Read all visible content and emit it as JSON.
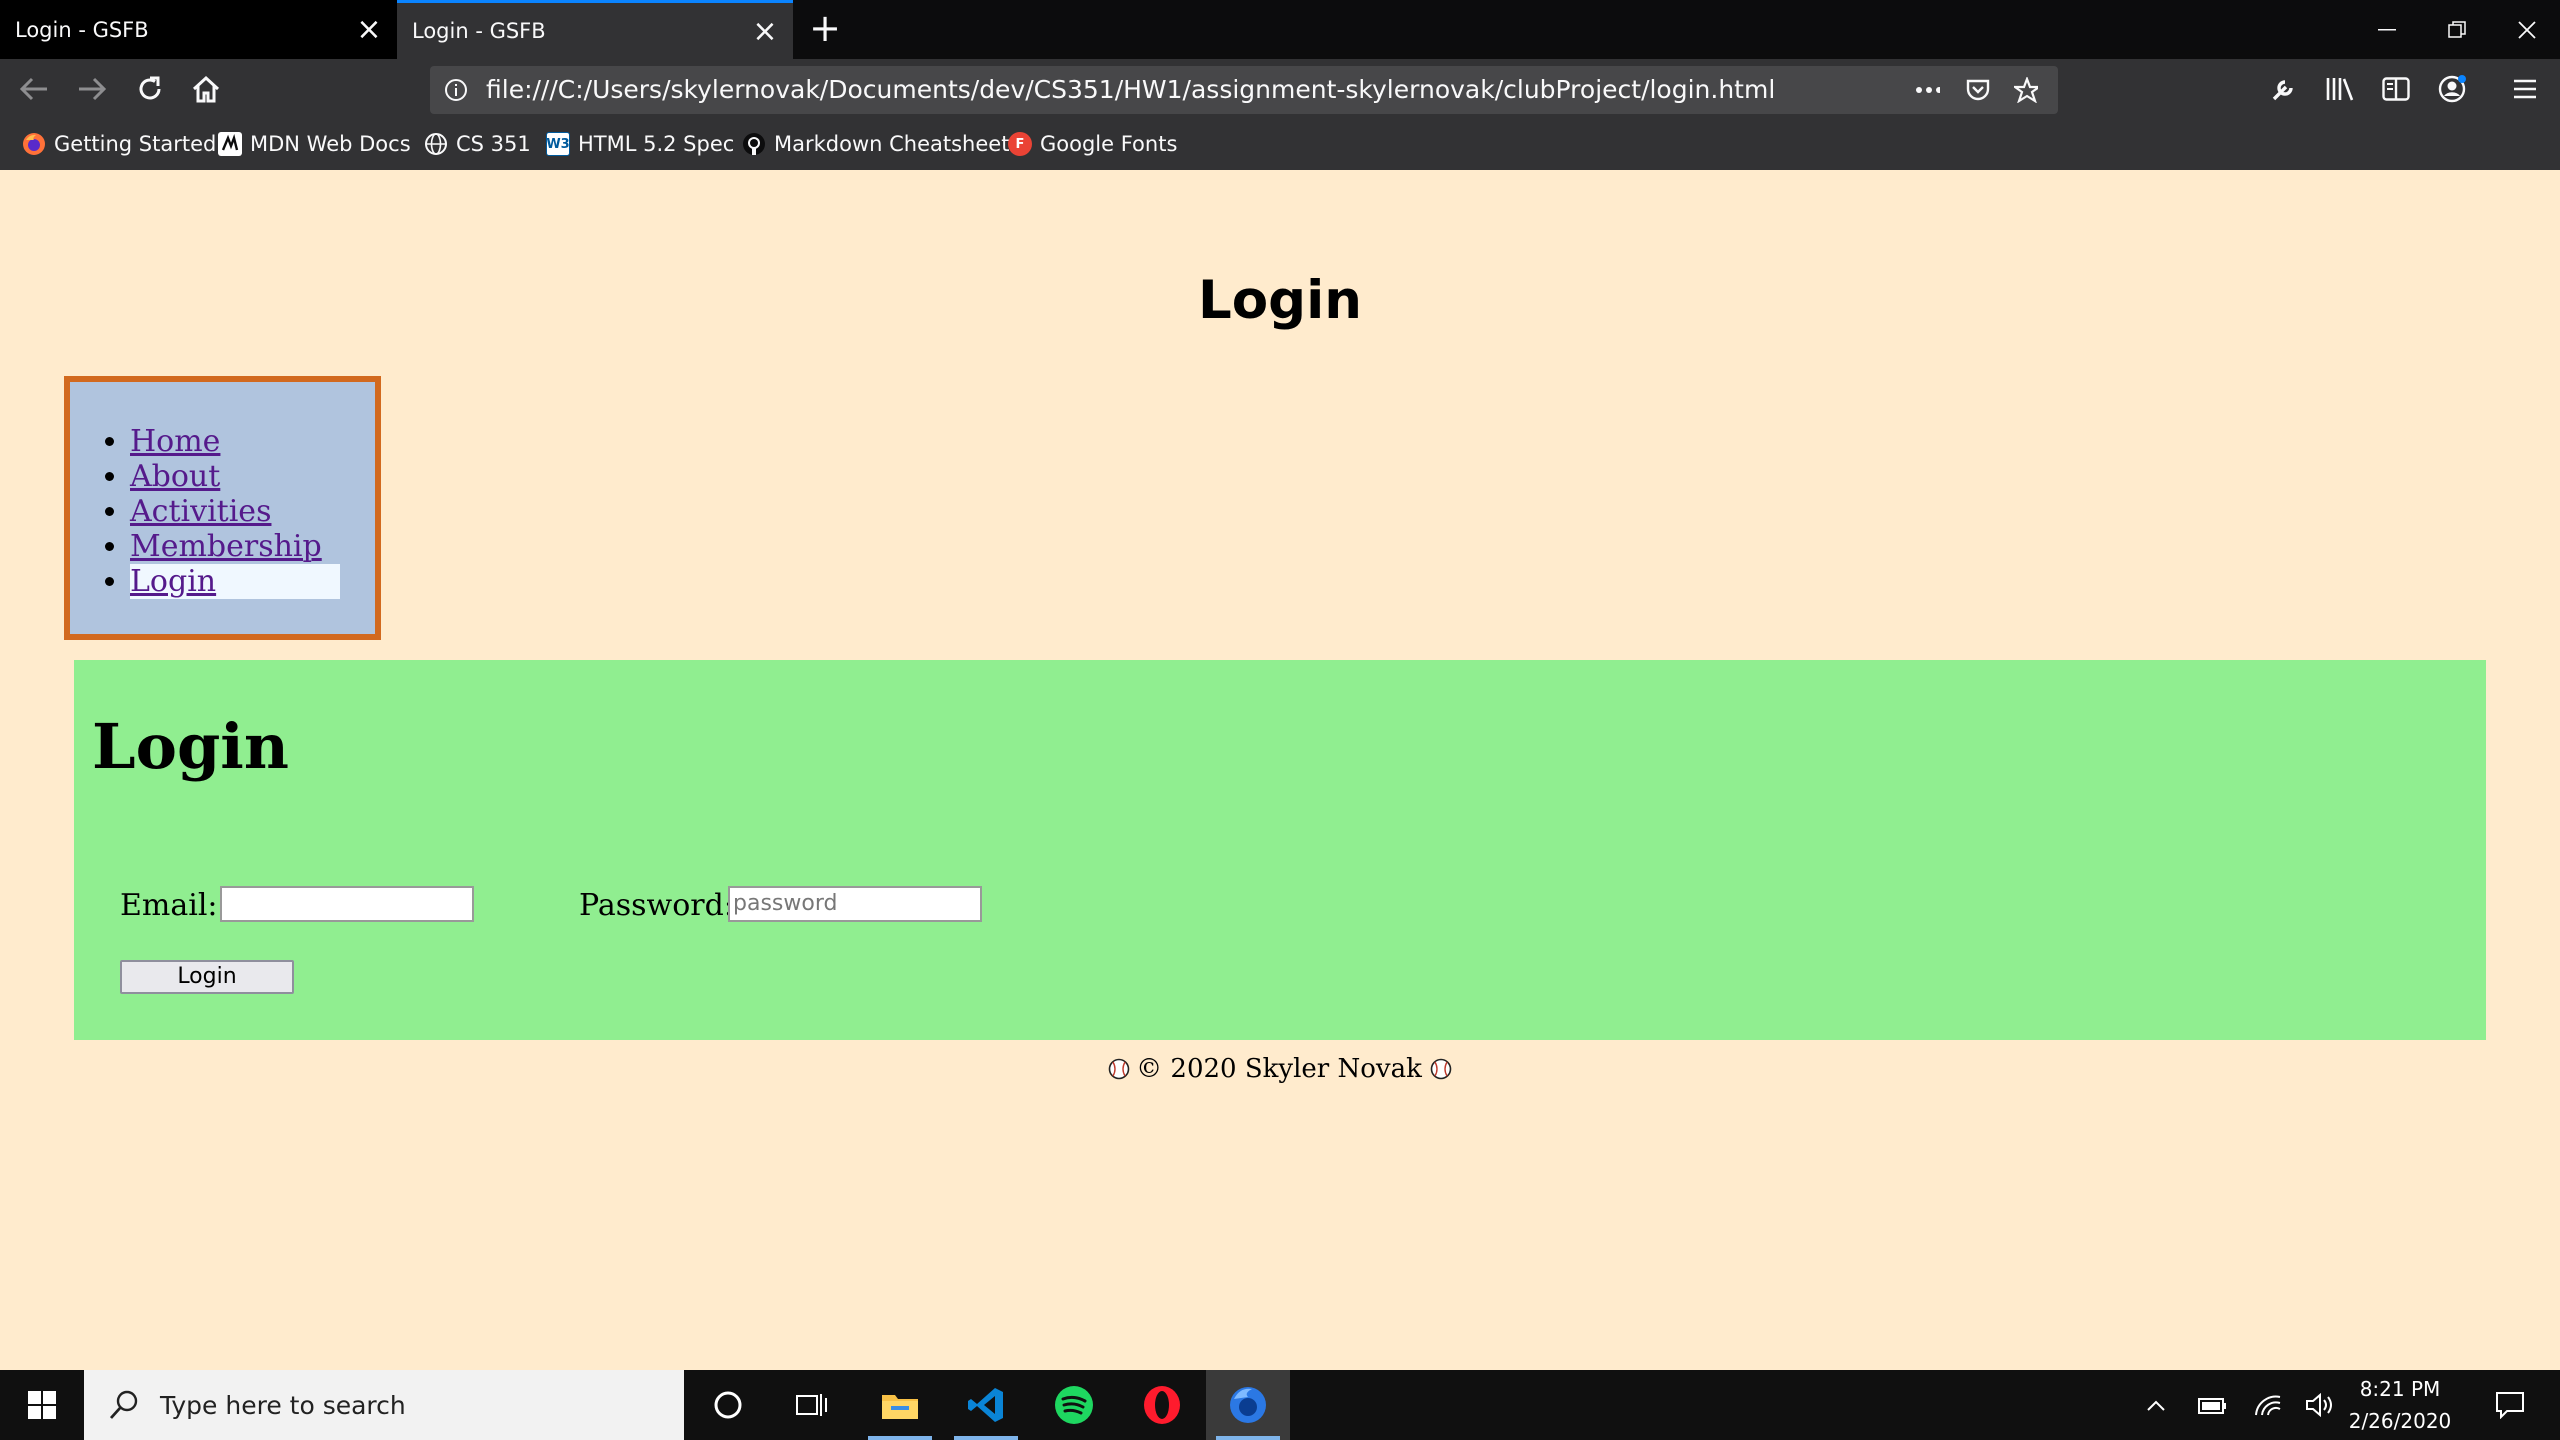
{
  "browser": {
    "tabs": [
      {
        "title": "Login - GSFB",
        "active": false
      },
      {
        "title": "Login - GSFB",
        "active": true
      }
    ],
    "url": "file:///C:/Users/skylernovak/Documents/dev/CS351/HW1/assignment-skylernovak/clubProject/login.html",
    "bookmarks": [
      {
        "label": "Getting Started",
        "icon": "firefox-icon"
      },
      {
        "label": "MDN Web Docs",
        "icon": "mdn-icon"
      },
      {
        "label": "CS 351",
        "icon": "globe-icon"
      },
      {
        "label": "HTML 5.2 Spec",
        "icon": "w3c-icon"
      },
      {
        "label": "Markdown Cheatsheet",
        "icon": "github-icon"
      },
      {
        "label": "Google Fonts",
        "icon": "google-fonts-icon"
      }
    ]
  },
  "page": {
    "site_title": "Login",
    "nav": [
      "Home",
      "About",
      "Activities",
      "Membership",
      "Login"
    ],
    "heading": "Login",
    "email_label": "Email:",
    "email_value": "",
    "password_label": "Password:",
    "password_placeholder": "password",
    "login_button": "Login",
    "footer_text": "© 2020 Skyler Novak"
  },
  "taskbar": {
    "search_placeholder": "Type here to search",
    "time": "8:21 PM",
    "date": "2/26/2020"
  },
  "colors": {
    "page_bg": "#ffebcd",
    "nav_bg": "#b0c4de",
    "nav_border": "#d2691e",
    "main_bg": "#90ee90",
    "link": "#551a8b",
    "accent": "#0a84ff"
  }
}
